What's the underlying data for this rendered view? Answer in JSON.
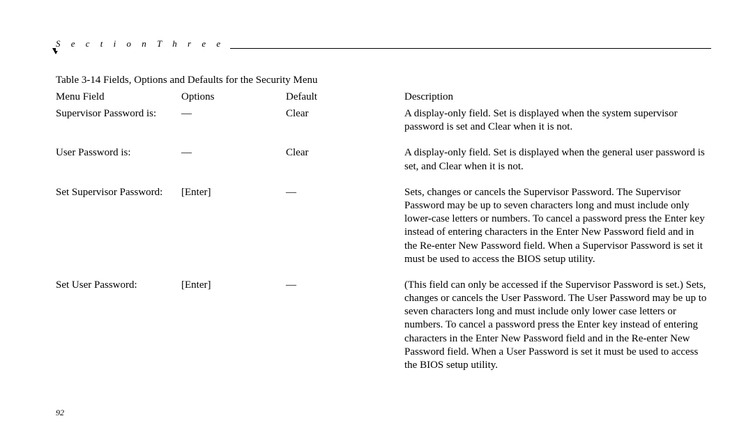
{
  "section_title": "S e c t i o n   T h r e e",
  "table_caption": "Table 3-14 Fields, Options and Defaults for the Security Menu",
  "columns": {
    "menu_field": "Menu Field",
    "options": "Options",
    "default": "Default",
    "description": "Description"
  },
  "rows": [
    {
      "menu_field": "Supervisor Password is:",
      "options": "—",
      "default": "Clear",
      "description": "A display-only field. Set is displayed when the system supervisor password is set and Clear when it is not."
    },
    {
      "menu_field": "User Password is:",
      "options": "—",
      "default": "Clear",
      "description": "A display-only field. Set is displayed when the general user password is set, and Clear when it is not."
    },
    {
      "menu_field": "Set Supervisor Password:",
      "options": "[Enter]",
      "default": "—",
      "description": "Sets, changes or cancels the Supervisor Password. The Supervisor Password may be up to seven characters long and must include only lower-case letters or numbers. To cancel a password press the Enter key instead of entering characters in the Enter New Password field and in the Re-enter New Password field. When a Supervisor Password is set it must be used to access the BIOS setup utility."
    },
    {
      "menu_field": "Set User Password:",
      "options": "[Enter]",
      "default": "—",
      "description": "(This field can only be accessed if the Supervisor Password is set.) Sets, changes or cancels the User Password. The User Password may be up to seven characters long and must include only lower case letters or numbers. To cancel a password press the Enter key instead of entering characters in the Enter New Password field and in the Re-enter New Password field. When a User Password is set it must be used to access the BIOS setup utility."
    }
  ],
  "page_number": "92"
}
